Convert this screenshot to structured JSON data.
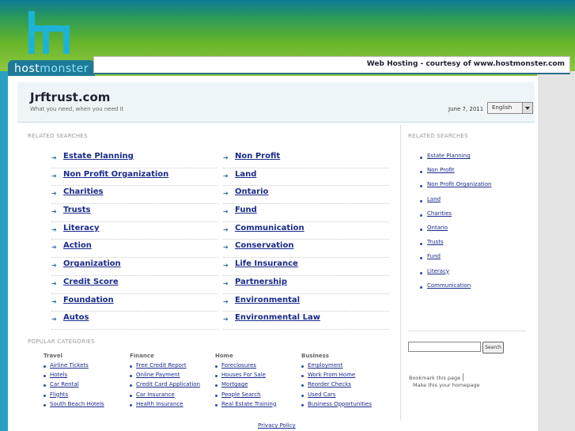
{
  "header": {
    "logo_text_a": "host",
    "logo_text_b": "monster",
    "banner_text": "Web Hosting - courtesy of www.hostmonster.com"
  },
  "site": {
    "title": "Jrftrust.com",
    "tagline": "What you need, when you need it",
    "date": "June 7, 2011",
    "language": "English"
  },
  "related": {
    "label": "RELATED SEARCHES",
    "left": [
      "Estate Planning",
      "Non Profit Organization",
      "Charities",
      "Trusts",
      "Literacy",
      "Action",
      "Organization",
      "Credit Score",
      "Foundation",
      "Autos"
    ],
    "right": [
      "Non Profit",
      "Land",
      "Ontario",
      "Fund",
      "Communication",
      "Conservation",
      "Life Insurance",
      "Partnership",
      "Environmental",
      "Environmental Law"
    ]
  },
  "sidebar": {
    "label": "RELATED SEARCHES",
    "items": [
      "Estate Planning",
      "Non Profit",
      "Non Profit Organization",
      "Land",
      "Charities",
      "Ontario",
      "Trusts",
      "Fund",
      "Literacy",
      "Communication"
    ],
    "search_button": "Search",
    "bookmark": "Bookmark this page",
    "homepage": "Make this your homepage"
  },
  "popular": {
    "label": "POPULAR CATEGORIES",
    "columns": [
      {
        "heading": "Travel",
        "items": [
          "Airline Tickets",
          "Hotels",
          "Car Rental",
          "Flights",
          "South Beach Hotels"
        ]
      },
      {
        "heading": "Finance",
        "items": [
          "Free Credit Report",
          "Online Payment",
          "Credit Card Application",
          "Car Insurance",
          "Health Insurance"
        ]
      },
      {
        "heading": "Home",
        "items": [
          "Foreclosures",
          "Houses For Sale",
          "Mortgage",
          "People Search",
          "Real Estate Training"
        ]
      },
      {
        "heading": "Business",
        "items": [
          "Employment",
          "Work From Home",
          "Reorder Checks",
          "Used Cars",
          "Business Opportunities"
        ]
      }
    ]
  },
  "footer": {
    "privacy": "Privacy Policy"
  },
  "colors": {
    "link": "#1a2a8a",
    "brand_blue": "#1db3d6",
    "green": "#8cc63f"
  }
}
